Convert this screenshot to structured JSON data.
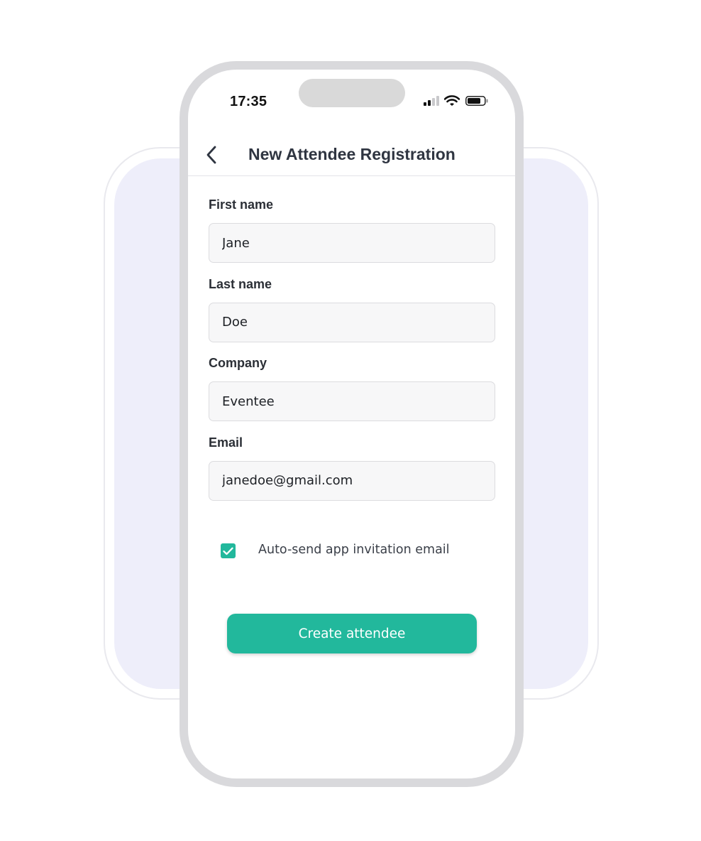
{
  "status_bar": {
    "time": "17:35",
    "icons": [
      "signal-icon",
      "wifi-icon",
      "battery-icon"
    ]
  },
  "header": {
    "back_icon": "chevron-left-icon",
    "title": "New Attendee Registration"
  },
  "form": {
    "fields": [
      {
        "label": "First name",
        "value": "Jane"
      },
      {
        "label": "Last name",
        "value": "Doe"
      },
      {
        "label": "Company",
        "value": "Eventee"
      },
      {
        "label": "Email",
        "value": "janedoe@gmail.com"
      }
    ],
    "checkbox": {
      "label": "Auto-send app invitation email",
      "checked": true,
      "icon": "checkmark-icon"
    },
    "submit_label": "Create attendee"
  },
  "colors": {
    "accent": "#22b89c",
    "card_background": "#eeeefa",
    "phone_frame": "#d9d9dc",
    "title_text": "#2f3541"
  }
}
